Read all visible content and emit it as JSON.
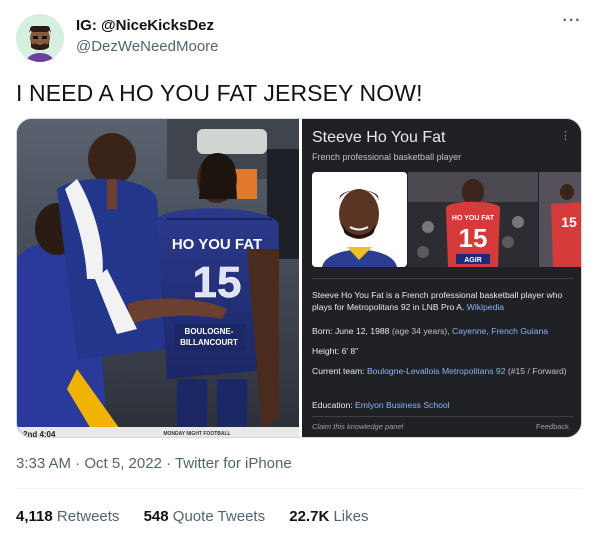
{
  "author": {
    "display_name": "IG: @NiceKicksDez",
    "handle": "@DezWeNeedMoore",
    "avatar_icon": "cartoon-avatar-icon"
  },
  "more_icon": "more-dots-icon",
  "tweet": {
    "text": "I NEED A HO YOU FAT JERSEY NOW!",
    "timestamp": "3:33 AM · Oct 5, 2022 · Twitter for iPhone"
  },
  "left_photo": {
    "jersey_name": "HO YOU FAT",
    "jersey_number": "15",
    "shorts_text_1": "BOULOGNE-",
    "shorts_text_2": "BILLANCOURT",
    "banner_text": "MONDAY NIGHT FOOTBALL",
    "score_text": "2nd 4:04"
  },
  "knowledge_panel": {
    "title": "Steeve Ho You Fat",
    "subtitle": "French professional basketball player",
    "photo_jersey_name": "HO YOU FAT",
    "photo_jersey_number": "15",
    "photo_sponsor": "AGIR",
    "description": "Steeve Ho You Fat is a French professional basketball player who plays for Metropolitans 92 in LNB Pro A.",
    "description_link": "Wikipedia",
    "born_label": "Born:",
    "born_value": "June 12, 1988",
    "born_age": "(age 34 years),",
    "born_place": "Cayenne, French Guiana",
    "height_label": "Height:",
    "height_value": "6′ 8″",
    "team_label": "Current team:",
    "team_value": "Boulogne-Levallois Metropolitans 92",
    "team_extra": "(#15 / Forward)",
    "education_label": "Education:",
    "education_value": "Emlyon Business School",
    "claim": "Claim this knowledge panel",
    "feedback": "Feedback"
  },
  "stats": {
    "retweets_count": "4,118",
    "retweets_label": "Retweets",
    "quotes_count": "548",
    "quotes_label": "Quote Tweets",
    "likes_count": "22.7K",
    "likes_label": "Likes"
  }
}
